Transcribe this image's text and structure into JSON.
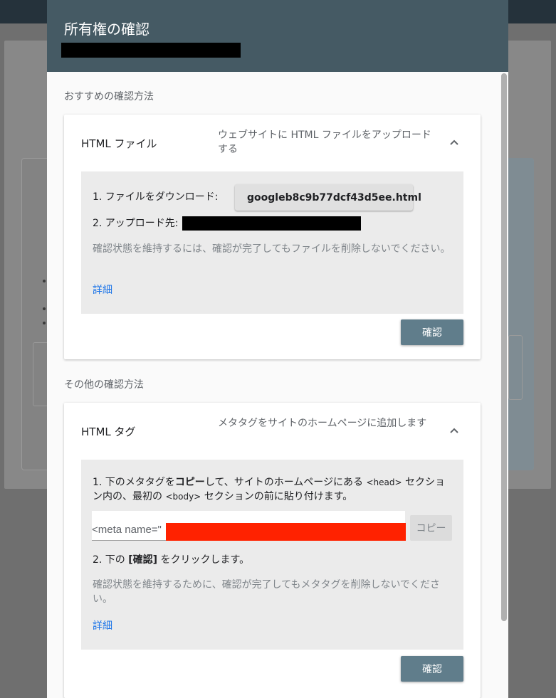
{
  "dialog": {
    "title": "所有権の確認"
  },
  "recommended": {
    "section_label": "おすすめの確認方法",
    "method_title": "HTML ファイル",
    "method_desc": "ウェブサイトに HTML ファイルをアップロードする",
    "step1_label": "1. ファイルをダウンロード:",
    "download_filename": "googleb8c9b77dcf43d5ee.html",
    "step2_label": "2. アップロード先:",
    "note": "確認状態を維持するには、確認が完了してもファイルを削除しないでください。",
    "details_link": "詳細",
    "verify_label": "確認"
  },
  "other": {
    "section_label": "その他の確認方法",
    "method_title": "HTML タグ",
    "method_desc": "メタタグをサイトのホームページに追加します",
    "step1_a": "1. 下のメタタグを",
    "step1_bold": "コピー",
    "step1_b": "して、サイトのホームページにある ",
    "step1_head": "<head>",
    "step1_c": " セクション内の、最初の ",
    "step1_body": "<body>",
    "step1_d": " セクションの前に貼り付けます。",
    "meta_value": "<meta name=\"",
    "copy_label": "コピー",
    "step2_a": "2. 下の ",
    "step2_bold": "[確認]",
    "step2_b": " をクリックします。",
    "note": "確認状態を維持するために、確認が完了してもメタタグを削除しないでください。",
    "details_link": "詳細",
    "verify_label": "確認"
  },
  "colors": {
    "header": "#455a64",
    "button": "#607d8b",
    "link": "#1a73e8",
    "redaction_black": "#000000",
    "redaction_red": "#ff2200"
  },
  "icons": {
    "download": "download-icon",
    "chevron": "chevron-up-icon"
  }
}
